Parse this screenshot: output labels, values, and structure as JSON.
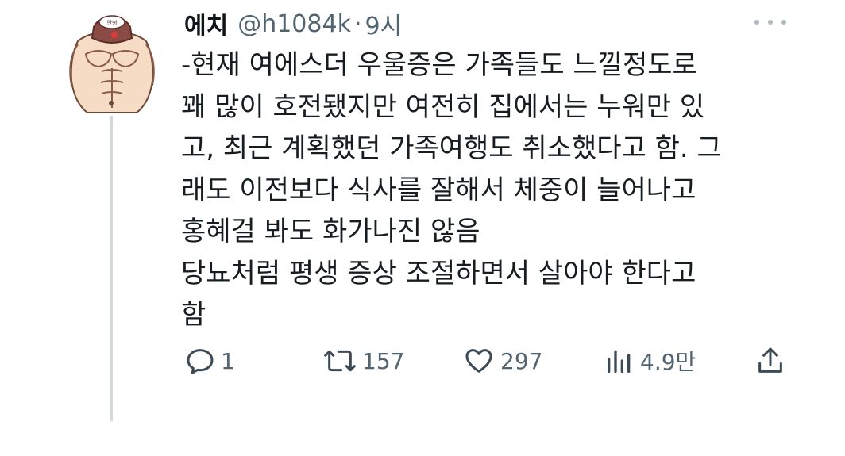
{
  "tweet": {
    "author_name": "에치",
    "handle": "@h1084k",
    "separator": "·",
    "time": "9시",
    "lines": [
      "-현재 여에스더 우울증은 가족들도 느낄정도로",
      "꽤 많이 호전됐지만 여전히 집에서는 누워만 있",
      "고, 최근 계획했던 가족여행도 취소했다고 함. 그",
      "래도 이전보다 식사를 잘해서 체중이 늘어나고",
      "홍혜걸 봐도 화가나진 않음",
      "당뇨처럼 평생 증상 조절하면서 살아야 한다고",
      "함"
    ]
  },
  "actions": {
    "reply_count": "1",
    "retweet_count": "157",
    "like_count": "297",
    "view_count": "4.9만"
  },
  "icons": {
    "reply": "reply-icon",
    "retweet": "retweet-icon",
    "like": "heart-icon",
    "views": "views-icon",
    "share": "share-icon",
    "more": "more-icon"
  },
  "colors": {
    "text": "#0f1419",
    "secondary": "#536471",
    "thread_line": "#cfd9de"
  }
}
